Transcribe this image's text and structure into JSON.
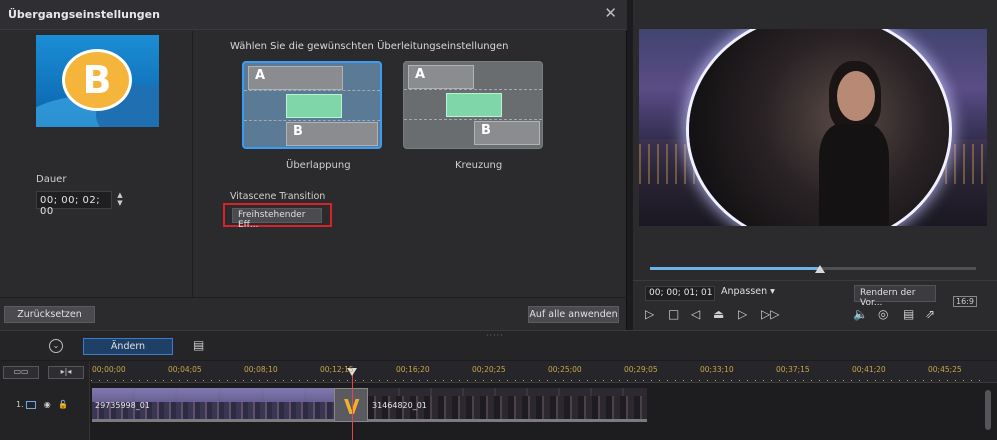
{
  "dialog": {
    "title": "Übergangseinstellungen",
    "close_glyph": "✕",
    "heading": "Wählen Sie die gewünschten Überleitungseinstellungen",
    "thumb_letter": "B",
    "duration_label": "Dauer",
    "duration_value": "00; 00; 02; 00",
    "options": [
      {
        "label": "Überlappung",
        "a": "A",
        "b": "B",
        "selected": true
      },
      {
        "label": "Kreuzung",
        "a": "A",
        "b": "B",
        "selected": false
      }
    ],
    "vitascene_label": "Vitascene Transition",
    "vitascene_button": "Freihstehender Eff...",
    "reset_button": "Zurücksetzen",
    "apply_all_button": "Auf alle anwenden"
  },
  "preview": {
    "timecode": "00; 00; 01; 01",
    "fit_label": "Anpassen ▾",
    "render_button": "Rendern der Vor...",
    "aspect": "16:9",
    "scrub_progress": 0.52
  },
  "toolbar": {
    "edit_button": "Ändern"
  },
  "timeline": {
    "ticks": [
      "00;00;00",
      "00;04;05",
      "00;08;10",
      "00;12;15",
      "00;16;20",
      "00;20;25",
      "00;25;00",
      "00;29;05",
      "00;33;10",
      "00;37;15",
      "00;41;20",
      "00;45;25"
    ],
    "track_number": "1.",
    "clips": [
      {
        "label": "29735998_01"
      },
      {
        "label": "31464820_01"
      }
    ],
    "transition_letter": "V"
  },
  "colors": {
    "selected_border": "#3b9cf2",
    "highlight_red": "#d4232b",
    "tick_gold": "#c8a545"
  }
}
